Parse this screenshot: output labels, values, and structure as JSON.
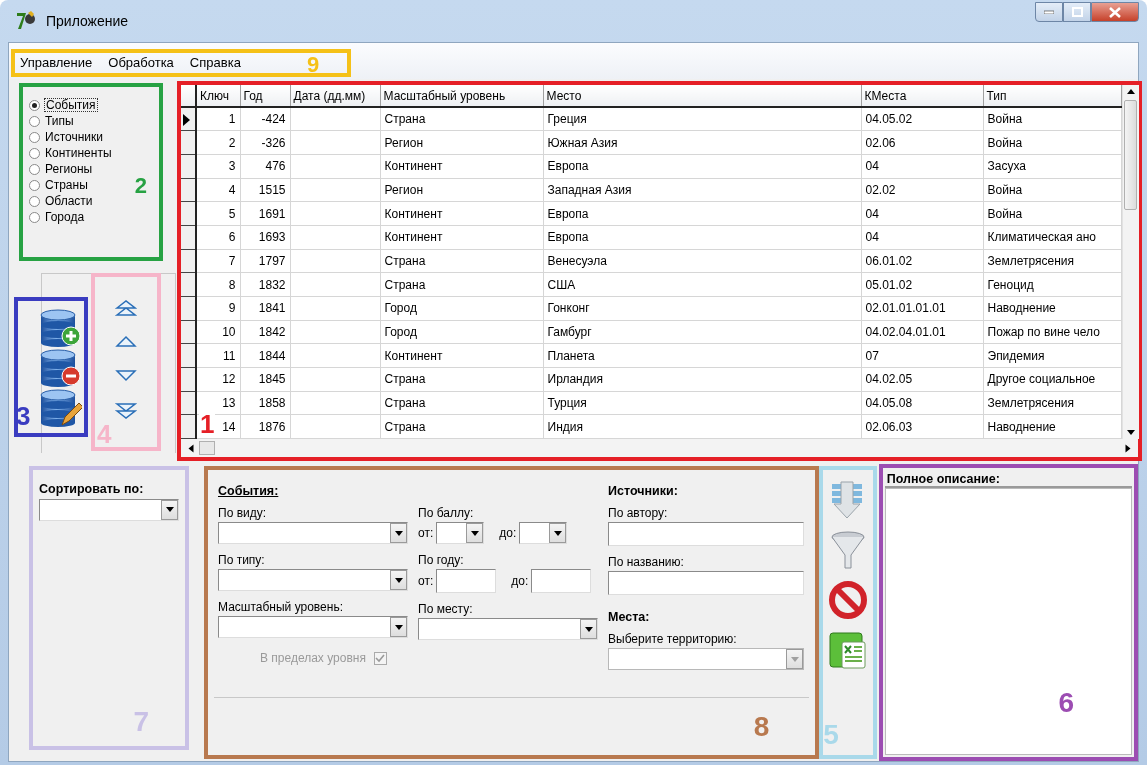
{
  "window": {
    "title": "Приложение"
  },
  "menu": {
    "items": [
      "Управление",
      "Обработка",
      "Справка"
    ],
    "callout": {
      "label": "9",
      "color": "#f5c118"
    }
  },
  "view_selector": {
    "options": [
      {
        "label": "События",
        "selected": true
      },
      {
        "label": "Типы",
        "selected": false
      },
      {
        "label": "Источники",
        "selected": false
      },
      {
        "label": "Континенты",
        "selected": false
      },
      {
        "label": "Регионы",
        "selected": false
      },
      {
        "label": "Страны",
        "selected": false
      },
      {
        "label": "Области",
        "selected": false
      },
      {
        "label": "Города",
        "selected": false
      }
    ],
    "callout": {
      "label": "2",
      "color": "#27a243"
    }
  },
  "record_buttons": {
    "buttons": [
      {
        "kind": "add"
      },
      {
        "kind": "remove"
      },
      {
        "kind": "edit"
      }
    ],
    "callout": {
      "label": "3",
      "color": "#3a3cc0"
    }
  },
  "move_buttons": {
    "buttons": [
      {
        "kind": "first"
      },
      {
        "kind": "up"
      },
      {
        "kind": "down"
      },
      {
        "kind": "last"
      }
    ],
    "callout": {
      "label": "4",
      "color": "#f6b5c9"
    }
  },
  "table": {
    "columns": [
      "Ключ",
      "Год",
      "Дата (дд.мм)",
      "Масштабный уровень",
      "Место",
      "КМеста",
      "Тип"
    ],
    "rows": [
      {
        "selected": true,
        "key": "1",
        "year": "-424",
        "level": "Страна",
        "place": "Греция",
        "place_code": "04.05.02",
        "type": "Война"
      },
      {
        "selected": false,
        "key": "2",
        "year": "-326",
        "level": "Регион",
        "place": "Южная Азия",
        "place_code": "02.06",
        "type": "Война"
      },
      {
        "selected": false,
        "key": "3",
        "year": "476",
        "level": "Континент",
        "place": "Европа",
        "place_code": "04",
        "type": "Засуха"
      },
      {
        "selected": false,
        "key": "4",
        "year": "1515",
        "level": "Регион",
        "place": "Западная Азия",
        "place_code": "02.02",
        "type": "Война"
      },
      {
        "selected": false,
        "key": "5",
        "year": "1691",
        "level": "Континент",
        "place": "Европа",
        "place_code": "04",
        "type": "Война"
      },
      {
        "selected": false,
        "key": "6",
        "year": "1693",
        "level": "Континент",
        "place": "Европа",
        "place_code": "04",
        "type": "Климатическая ано"
      },
      {
        "selected": false,
        "key": "7",
        "year": "1797",
        "level": "Страна",
        "place": "Венесуэла",
        "place_code": "06.01.02",
        "type": "Землетрясения"
      },
      {
        "selected": false,
        "key": "8",
        "year": "1832",
        "level": "Страна",
        "place": "США",
        "place_code": "05.01.02",
        "type": "Геноцид"
      },
      {
        "selected": false,
        "key": "9",
        "year": "1841",
        "level": "Город",
        "place": "Гонконг",
        "place_code": "02.01.01.01.01",
        "type": "Наводнение"
      },
      {
        "selected": false,
        "key": "10",
        "year": "1842",
        "level": "Город",
        "place": "Гамбург",
        "place_code": "04.02.04.01.01",
        "type": "Пожар по вине чело"
      },
      {
        "selected": false,
        "key": "11",
        "year": "1844",
        "level": "Континент",
        "place": "Планета",
        "place_code": "07",
        "type": "Эпидемия"
      },
      {
        "selected": false,
        "key": "12",
        "year": "1845",
        "level": "Страна",
        "place": "Ирландия",
        "place_code": "04.02.05",
        "type": "Другое социальное"
      },
      {
        "selected": false,
        "key": "13",
        "year": "1858",
        "level": "Страна",
        "place": "Турция",
        "place_code": "04.05.08",
        "type": "Землетрясения"
      },
      {
        "selected": false,
        "key": "14",
        "year": "1876",
        "level": "Страна",
        "place": "Индия",
        "place_code": "02.06.03",
        "type": "Наводнение"
      }
    ],
    "callout": {
      "label": "1",
      "color": "#e51f26"
    }
  },
  "sort": {
    "label": "Сортировать по:",
    "callout": {
      "label": "7",
      "color": "#c9c1e6"
    }
  },
  "filters": {
    "columns": [
      [
        {
          "kind": "heading",
          "text": "События:",
          "underline": true
        },
        {
          "kind": "label",
          "text": "По виду:"
        },
        {
          "kind": "combo",
          "disabled": false
        },
        {
          "kind": "label",
          "text": "По типу:"
        },
        {
          "kind": "combo",
          "disabled": false
        },
        {
          "kind": "label",
          "text": "Масштабный уровень:"
        },
        {
          "kind": "combo",
          "disabled": false
        },
        {
          "kind": "checkbox",
          "text": "В пределах уровня",
          "checked": true,
          "disabled": true
        }
      ],
      [
        {
          "kind": "label",
          "text": "По баллу:"
        },
        {
          "kind": "range_combo",
          "from": "от:",
          "to": "до:"
        },
        {
          "kind": "label",
          "text": "По году:"
        },
        {
          "kind": "range_input",
          "from": "от:",
          "to": "до:"
        },
        {
          "kind": "label",
          "text": "По месту:"
        },
        {
          "kind": "combo",
          "disabled": false
        }
      ],
      [
        {
          "kind": "heading",
          "text": "Источники:",
          "underline": false
        },
        {
          "kind": "label",
          "text": "По автору:"
        },
        {
          "kind": "input"
        },
        {
          "kind": "label",
          "text": "По названию:"
        },
        {
          "kind": "input"
        },
        {
          "kind": "heading",
          "text": "Места:",
          "underline": false
        },
        {
          "kind": "label",
          "text": "Выберите территорию:"
        },
        {
          "kind": "combo",
          "disabled": true
        }
      ]
    ],
    "callout": {
      "label": "8",
      "color": "#b8794f"
    }
  },
  "action_buttons": {
    "buttons": [
      {
        "kind": "import"
      },
      {
        "kind": "filter"
      },
      {
        "kind": "clear"
      },
      {
        "kind": "excel"
      }
    ],
    "callout": {
      "label": "5",
      "color": "#a9d9ea"
    }
  },
  "description": {
    "label": "Полное описание:",
    "callout": {
      "label": "6",
      "color": "#9c4db2"
    }
  }
}
